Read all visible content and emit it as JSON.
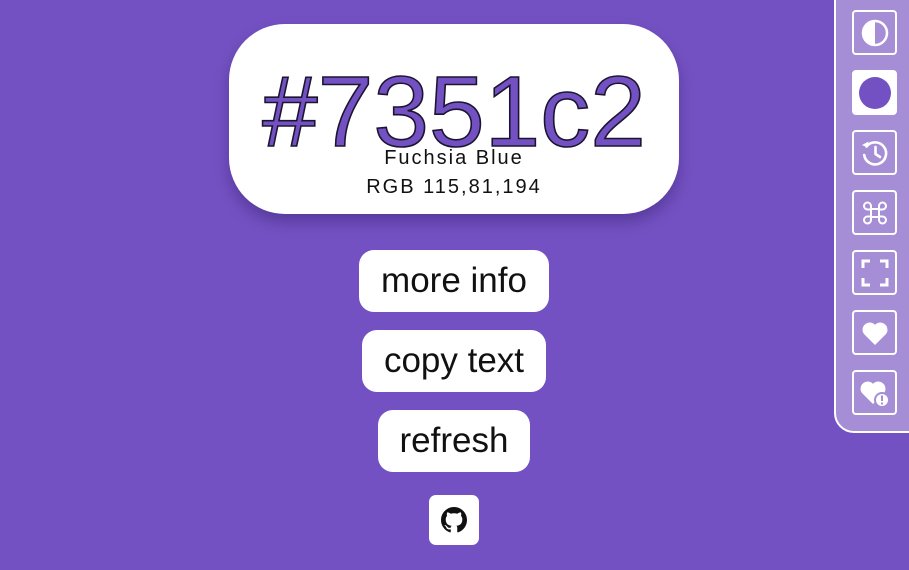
{
  "color": {
    "hex": "#7351c2",
    "name": "Fuchsia Blue",
    "rgb": "RGB 115,81,194"
  },
  "actions": {
    "more_info": "more info",
    "copy_text": "copy text",
    "refresh": "refresh"
  },
  "icons": {
    "github": "github-icon",
    "contrast": "contrast-icon",
    "color_swatch": "color-swatch-icon",
    "history": "history-icon",
    "command": "command-key-icon",
    "fullscreen": "fullscreen-icon",
    "favorite": "heart-icon",
    "favorites_info": "heart-info-icon"
  },
  "theme": {
    "background": "#7351c2",
    "card": "#ffffff",
    "sidebar": "#a68ed6",
    "text": "#111111"
  }
}
